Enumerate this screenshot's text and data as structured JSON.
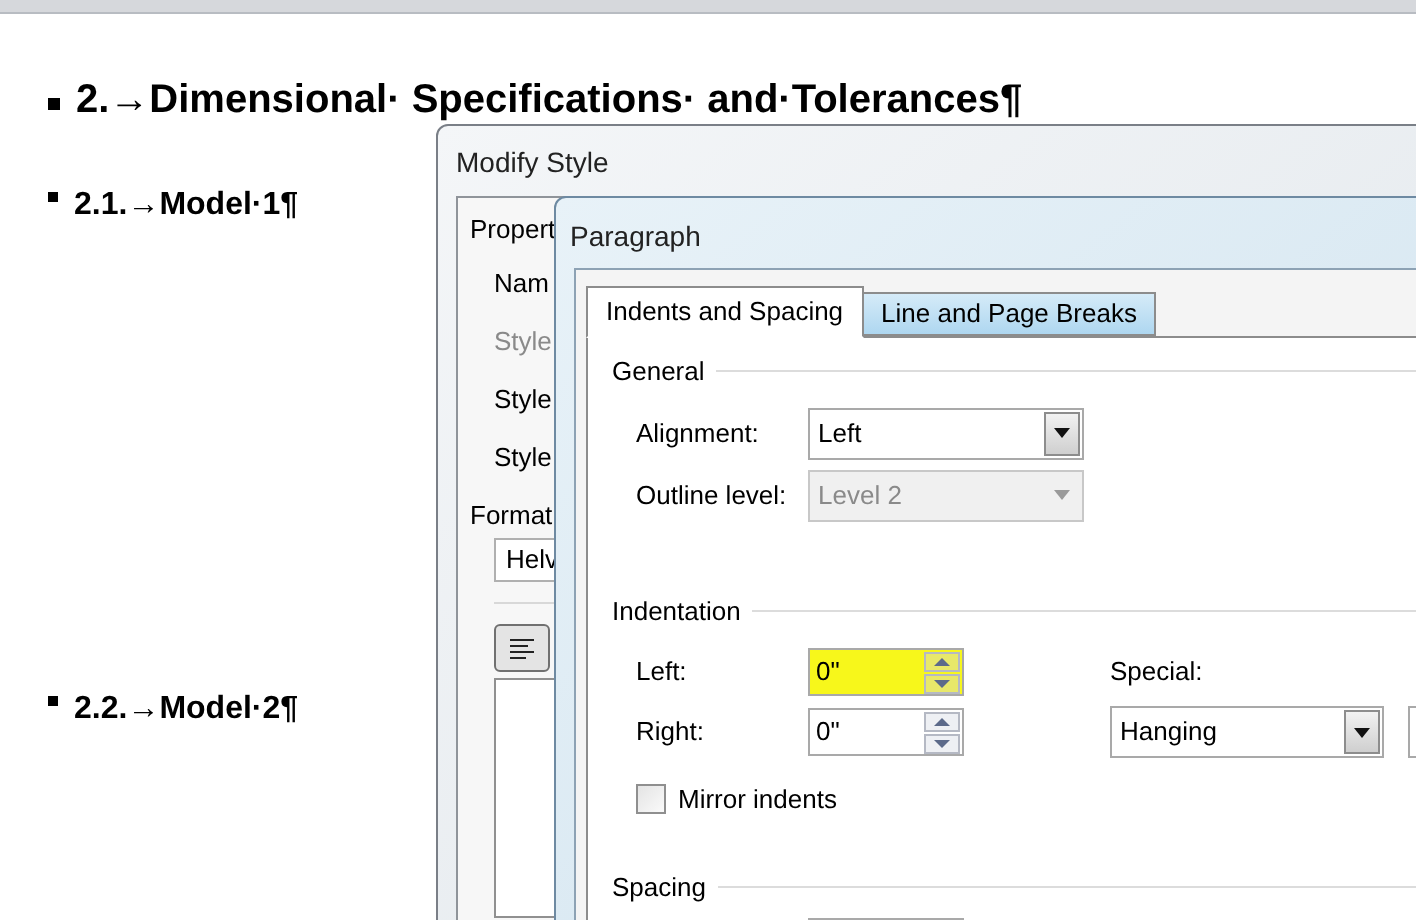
{
  "document": {
    "headings": [
      {
        "kind": "h1",
        "text": "2.→Dimensional· Specifications· and·Tolerances¶"
      },
      {
        "kind": "h2",
        "text": "2.1.→Model·1¶"
      },
      {
        "kind": "h2",
        "text": "2.2.→Model·2¶"
      }
    ]
  },
  "modify_style": {
    "title": "Modify Style",
    "section": "Propert",
    "rows": [
      {
        "label": "Nam",
        "disabled": false
      },
      {
        "label": "Style",
        "disabled": true
      },
      {
        "label": "Style",
        "disabled": false
      },
      {
        "label": "Style",
        "disabled": false
      }
    ],
    "format_label": "Format",
    "font_field": "Helv"
  },
  "paragraph": {
    "title": "Paragraph",
    "tabs": [
      {
        "label": "Indents and Spacing",
        "selected": true
      },
      {
        "label": "Line and Page Breaks",
        "selected": false
      }
    ],
    "general": {
      "heading": "General",
      "alignment": {
        "label": "Alignment:",
        "value": "Left",
        "disabled": false
      },
      "outline_level": {
        "label": "Outline level:",
        "value": "Level 2",
        "disabled": true
      }
    },
    "indentation": {
      "heading": "Indentation",
      "left": {
        "label": "Left:",
        "value": "0\"",
        "highlighted": true
      },
      "right": {
        "label": "Right:",
        "value": "0\"",
        "highlighted": false
      },
      "special": {
        "label": "Special:",
        "value": "Hanging"
      },
      "mirror_indents": {
        "label": "Mirror indents",
        "checked": false
      }
    },
    "spacing": {
      "heading": "Spacing"
    }
  }
}
